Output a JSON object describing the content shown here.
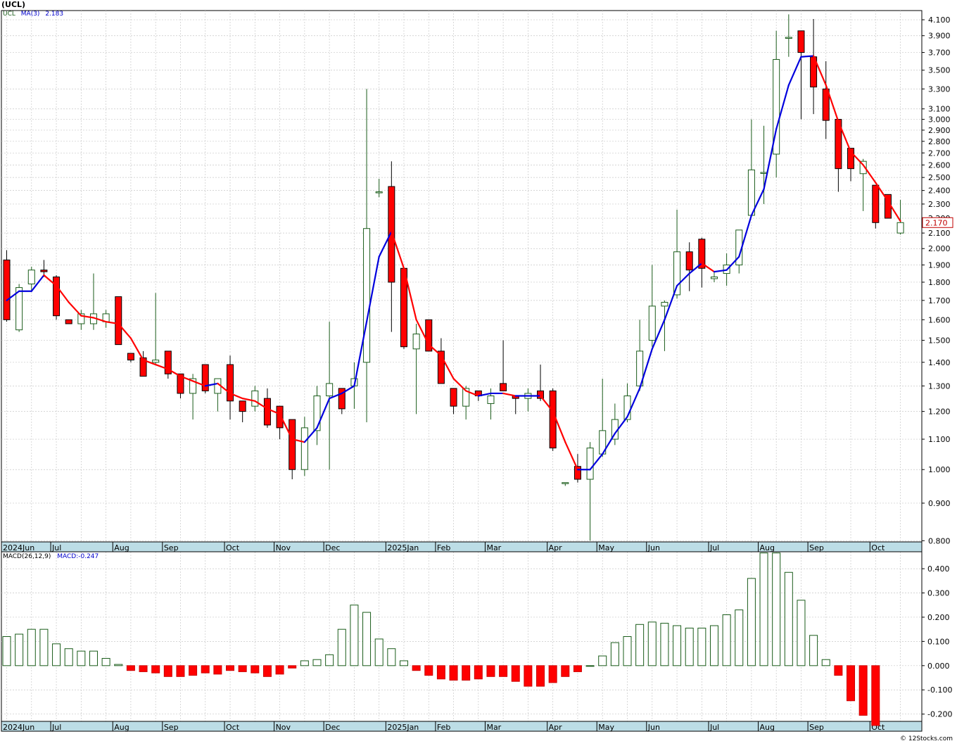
{
  "header": {
    "symbol_title": "(UCL)"
  },
  "legends": {
    "price": {
      "symbol": "UCL",
      "ma_label": "MA(3)",
      "ma_value": "2.183"
    },
    "macd": {
      "label": "MACD(26,12,9)",
      "value_label": "MACD:-0.247"
    }
  },
  "last_price_label": "2.170",
  "footer": "© 12Stocks.com",
  "colors": {
    "up": "#1a5c1a",
    "down": "#ff0000",
    "ma_up": "#0000dd",
    "ma_down": "#ff0000",
    "grid": "#c8c8c8",
    "axis_band": "#bcdde6"
  },
  "x_axis": {
    "labels": [
      "2024Jun",
      "Jul",
      "Aug",
      "Sep",
      "Oct",
      "Nov",
      "Dec",
      "2025Jan",
      "Feb",
      "Mar",
      "Apr",
      "May",
      "Jun",
      "Jul",
      "Aug",
      "Sep",
      "Oct"
    ],
    "label_week_index": [
      0,
      4,
      9,
      13,
      18,
      22,
      26,
      31,
      35,
      39,
      44,
      48,
      52,
      57,
      61,
      65,
      70
    ]
  },
  "chart_data": [
    {
      "type": "candlestick",
      "title": "(UCL)",
      "scale": "log",
      "ylim": [
        0.8,
        4.2
      ],
      "y_ticks": [
        "0.800",
        "0.900",
        "1.000",
        "1.100",
        "1.200",
        "1.300",
        "1.400",
        "1.500",
        "1.600",
        "1.700",
        "1.800",
        "1.900",
        "2.000",
        "2.100",
        "2.200",
        "2.300",
        "2.400",
        "2.500",
        "2.600",
        "2.700",
        "2.800",
        "2.900",
        "3.000",
        "3.100",
        "3.300",
        "3.500",
        "3.700",
        "3.900",
        "4.100"
      ],
      "x_labels": [
        "2024Jun",
        "Jul",
        "Aug",
        "Sep",
        "Oct",
        "Nov",
        "Dec",
        "2025Jan",
        "Feb",
        "Mar",
        "Apr",
        "May",
        "Jun",
        "Jul",
        "Aug",
        "Sep",
        "Oct"
      ],
      "series": [
        {
          "name": "UCL",
          "ohlc": [
            [
              1.93,
              1.99,
              1.59,
              1.6
            ],
            [
              1.55,
              1.79,
              1.54,
              1.77
            ],
            [
              1.79,
              1.89,
              1.75,
              1.87
            ],
            [
              1.87,
              1.93,
              1.83,
              1.86
            ],
            [
              1.83,
              1.84,
              1.6,
              1.62
            ],
            [
              1.6,
              1.6,
              1.58,
              1.58
            ],
            [
              1.58,
              1.65,
              1.55,
              1.63
            ],
            [
              1.58,
              1.85,
              1.55,
              1.63
            ],
            [
              1.59,
              1.65,
              1.56,
              1.63
            ],
            [
              1.72,
              1.72,
              1.48,
              1.48
            ],
            [
              1.44,
              1.44,
              1.4,
              1.41
            ],
            [
              1.42,
              1.45,
              1.34,
              1.34
            ],
            [
              1.4,
              1.74,
              1.39,
              1.41
            ],
            [
              1.45,
              1.45,
              1.33,
              1.35
            ],
            [
              1.35,
              1.35,
              1.25,
              1.27
            ],
            [
              1.27,
              1.35,
              1.17,
              1.33
            ],
            [
              1.39,
              1.39,
              1.27,
              1.28
            ],
            [
              1.27,
              1.32,
              1.2,
              1.33
            ],
            [
              1.39,
              1.43,
              1.17,
              1.24
            ],
            [
              1.24,
              1.24,
              1.16,
              1.2
            ],
            [
              1.22,
              1.3,
              1.2,
              1.28
            ],
            [
              1.25,
              1.29,
              1.14,
              1.15
            ],
            [
              1.22,
              1.22,
              1.1,
              1.14
            ],
            [
              1.17,
              1.17,
              0.97,
              1.0
            ],
            [
              1.0,
              1.18,
              0.98,
              1.14
            ],
            [
              1.13,
              1.3,
              1.08,
              1.26
            ],
            [
              1.26,
              1.59,
              1.0,
              1.31
            ],
            [
              1.29,
              1.29,
              1.19,
              1.21
            ],
            [
              1.3,
              1.4,
              1.21,
              1.33
            ],
            [
              1.4,
              3.3,
              1.16,
              2.13
            ],
            [
              2.39,
              2.49,
              2.35,
              2.39
            ],
            [
              2.43,
              2.63,
              1.54,
              1.8
            ],
            [
              1.88,
              1.88,
              1.46,
              1.47
            ],
            [
              1.46,
              1.58,
              1.19,
              1.53
            ],
            [
              1.6,
              1.6,
              1.45,
              1.45
            ],
            [
              1.45,
              1.51,
              1.31,
              1.31
            ],
            [
              1.29,
              1.29,
              1.19,
              1.22
            ],
            [
              1.22,
              1.3,
              1.17,
              1.29
            ],
            [
              1.28,
              1.28,
              1.24,
              1.26
            ],
            [
              1.23,
              1.29,
              1.17,
              1.26
            ],
            [
              1.31,
              1.5,
              1.28,
              1.28
            ],
            [
              1.26,
              1.26,
              1.19,
              1.25
            ],
            [
              1.25,
              1.29,
              1.2,
              1.27
            ],
            [
              1.28,
              1.39,
              1.24,
              1.25
            ],
            [
              1.28,
              1.29,
              1.06,
              1.07
            ],
            [
              0.96,
              0.96,
              0.95,
              0.96
            ],
            [
              1.01,
              1.05,
              0.96,
              0.97
            ],
            [
              0.97,
              1.09,
              0.8,
              1.07
            ],
            [
              1.05,
              1.33,
              1.04,
              1.13
            ],
            [
              1.1,
              1.23,
              1.08,
              1.17
            ],
            [
              1.17,
              1.31,
              1.16,
              1.26
            ],
            [
              1.3,
              1.6,
              1.28,
              1.45
            ],
            [
              1.5,
              1.9,
              1.47,
              1.67
            ],
            [
              1.67,
              1.7,
              1.45,
              1.69
            ],
            [
              1.73,
              2.26,
              1.71,
              1.98
            ],
            [
              1.98,
              2.04,
              1.75,
              1.87
            ],
            [
              2.06,
              2.07,
              1.77,
              1.88
            ],
            [
              1.82,
              1.86,
              1.8,
              1.83
            ],
            [
              1.85,
              1.97,
              1.78,
              1.9
            ],
            [
              1.9,
              2.12,
              1.85,
              2.12
            ],
            [
              2.22,
              3.0,
              2.22,
              2.56
            ],
            [
              2.54,
              2.94,
              2.3,
              2.54
            ],
            [
              2.69,
              3.96,
              2.5,
              3.62
            ],
            [
              3.88,
              4.17,
              3.65,
              3.88
            ],
            [
              3.96,
              3.96,
              3.0,
              3.7
            ],
            [
              3.65,
              4.11,
              3.05,
              3.32
            ],
            [
              3.3,
              3.6,
              2.82,
              2.99
            ],
            [
              3.0,
              3.0,
              2.39,
              2.57
            ],
            [
              2.74,
              2.74,
              2.47,
              2.57
            ],
            [
              2.53,
              2.65,
              2.25,
              2.63
            ],
            [
              2.44,
              2.44,
              2.13,
              2.17
            ],
            [
              2.37,
              2.37,
              2.2,
              2.2
            ],
            [
              2.1,
              2.33,
              2.09,
              2.17
            ]
          ]
        },
        {
          "name": "MA(3)",
          "values": [
            1.7,
            1.75,
            1.75,
            1.84,
            1.78,
            1.69,
            1.62,
            1.61,
            1.59,
            1.58,
            1.51,
            1.41,
            1.39,
            1.37,
            1.34,
            1.32,
            1.3,
            1.31,
            1.27,
            1.25,
            1.24,
            1.21,
            1.19,
            1.1,
            1.09,
            1.14,
            1.25,
            1.27,
            1.3,
            1.59,
            1.95,
            2.11,
            1.88,
            1.6,
            1.48,
            1.43,
            1.33,
            1.28,
            1.26,
            1.27,
            1.27,
            1.26,
            1.26,
            1.26,
            1.2,
            1.09,
            1.0,
            1.0,
            1.05,
            1.12,
            1.18,
            1.29,
            1.46,
            1.6,
            1.78,
            1.85,
            1.91,
            1.86,
            1.87,
            1.95,
            2.22,
            2.41,
            2.91,
            3.34,
            3.65,
            3.66,
            3.34,
            2.98,
            2.71,
            2.6,
            2.46,
            2.32,
            2.18
          ]
        }
      ]
    },
    {
      "type": "bar",
      "title": "MACD(26,12,9)",
      "ylim": [
        -0.23,
        0.47
      ],
      "y_ticks": [
        "-0.200",
        "-0.100",
        "0.000",
        "0.100",
        "0.200",
        "0.300",
        "0.400"
      ],
      "x_labels": [
        "2024Jun",
        "Jul",
        "Aug",
        "Sep",
        "Oct",
        "Nov",
        "Dec",
        "2025Jan",
        "Feb",
        "Mar",
        "Apr",
        "May",
        "Jun",
        "Jul",
        "Aug",
        "Sep",
        "Oct"
      ],
      "series": [
        {
          "name": "MACD",
          "values": [
            0.12,
            0.13,
            0.15,
            0.15,
            0.09,
            0.07,
            0.06,
            0.06,
            0.03,
            0.005,
            -0.02,
            -0.025,
            -0.03,
            -0.045,
            -0.045,
            -0.04,
            -0.03,
            -0.035,
            -0.02,
            -0.025,
            -0.03,
            -0.045,
            -0.035,
            -0.01,
            0.02,
            0.025,
            0.045,
            0.15,
            0.25,
            0.22,
            0.11,
            0.07,
            0.02,
            -0.02,
            -0.04,
            -0.055,
            -0.06,
            -0.06,
            -0.055,
            -0.045,
            -0.045,
            -0.065,
            -0.085,
            -0.085,
            -0.07,
            -0.045,
            -0.025,
            0.0,
            0.04,
            0.095,
            0.12,
            0.17,
            0.18,
            0.175,
            0.165,
            0.155,
            0.155,
            0.165,
            0.21,
            0.23,
            0.36,
            0.465,
            0.465,
            0.385,
            0.27,
            0.125,
            0.025,
            -0.04,
            -0.145,
            -0.205,
            -0.247
          ]
        }
      ]
    }
  ]
}
